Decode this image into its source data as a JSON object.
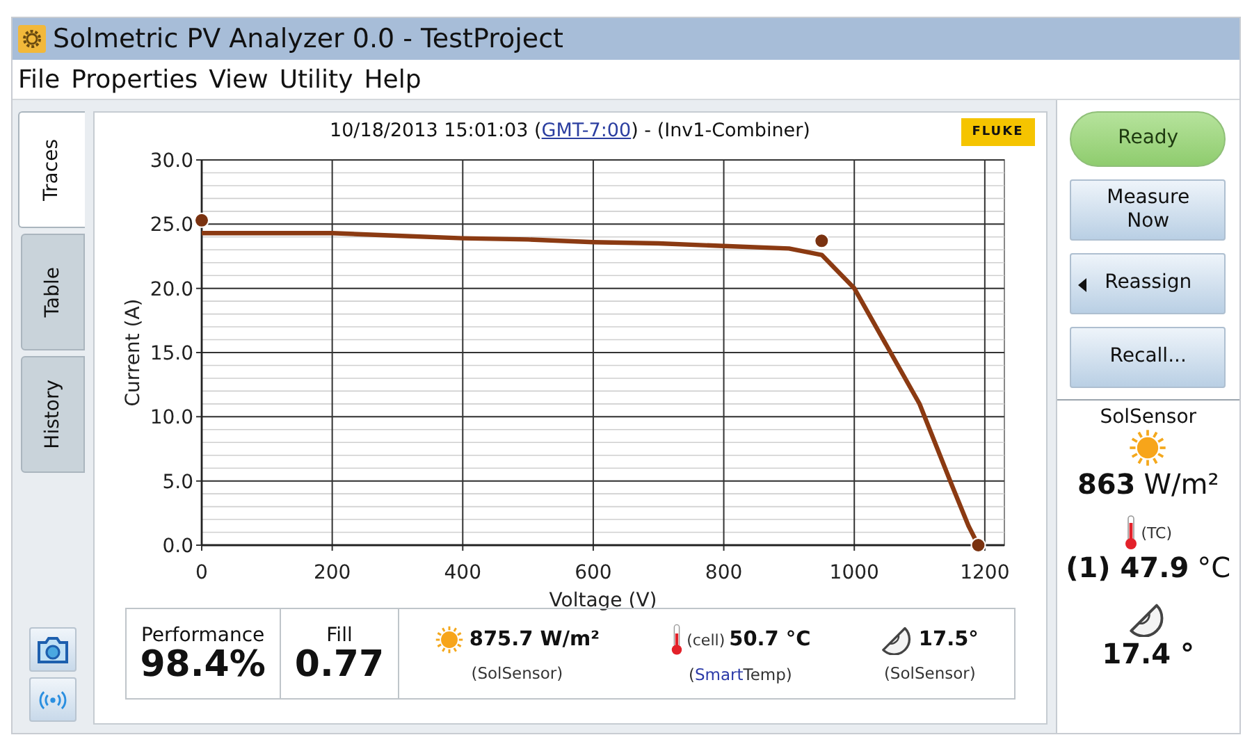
{
  "window": {
    "title": "Solmetric PV Analyzer 0.0 - TestProject"
  },
  "menu": [
    "File",
    "Properties",
    "View",
    "Utility",
    "Help"
  ],
  "side_tabs": [
    {
      "label": "Traces",
      "selected": true
    },
    {
      "label": "Table",
      "selected": false
    },
    {
      "label": "History",
      "selected": false
    }
  ],
  "side_tools": [
    {
      "kind": "camera"
    },
    {
      "kind": "wireless"
    }
  ],
  "header": {
    "before": "10/18/2013 15:01:03 (",
    "link": "GMT-7:00",
    "after": ") - (Inv1-Combiner)",
    "logo": "FLUKE"
  },
  "chart_data": {
    "type": "line",
    "xlabel": "Voltage (V)",
    "ylabel": "Current (A)",
    "x": [
      0,
      100,
      200,
      300,
      400,
      500,
      600,
      700,
      800,
      900,
      950,
      1000,
      1050,
      1100,
      1150,
      1175,
      1190
    ],
    "series": [
      {
        "color": "#8b3a12",
        "values": [
          24.3,
          24.3,
          24.3,
          24.1,
          23.9,
          23.8,
          23.6,
          23.5,
          23.3,
          23.1,
          22.6,
          20.0,
          15.5,
          11.0,
          4.6,
          1.5,
          0
        ]
      },
      {
        "type": "scatter",
        "color": "#7a3210",
        "values": [
          25.3,
          null,
          null,
          null,
          null,
          null,
          null,
          null,
          null,
          null,
          23.7,
          null,
          null,
          null,
          null,
          null,
          0
        ]
      }
    ],
    "grid": true,
    "xlim": [
      0,
      1230
    ],
    "ylim": [
      0,
      30
    ],
    "xticks": [
      0,
      200,
      400,
      600,
      800,
      1000,
      1200
    ],
    "yticks": [
      {
        "value": 0,
        "label": "0.0"
      },
      {
        "value": 5,
        "label": "5.0"
      },
      {
        "value": 10,
        "label": "10.0"
      },
      {
        "value": 15,
        "label": "15.0"
      },
      {
        "value": 20,
        "label": "20.0"
      },
      {
        "value": 25,
        "label": "25.0"
      },
      {
        "value": 30,
        "label": "30.0"
      }
    ]
  },
  "stats": [
    {
      "label": "Performance",
      "value": "98.4%"
    },
    {
      "label": "Fill",
      "value": "0.77"
    }
  ],
  "readings": [
    {
      "kind": "sun",
      "value": "875.7 W/m²",
      "source": [
        {
          "text": "(SolSensor)",
          "accent": false
        }
      ]
    },
    {
      "kind": "thermometer",
      "note": "(cell)",
      "value": "50.7 °C",
      "source": [
        {
          "text": "(",
          "accent": false
        },
        {
          "text": "Smart",
          "accent": true
        },
        {
          "text": "Temp)",
          "accent": false
        }
      ]
    },
    {
      "kind": "protractor",
      "value": "17.5°",
      "source": [
        {
          "text": "(SolSensor)",
          "accent": false
        }
      ]
    }
  ],
  "actions": [
    {
      "kind": "status",
      "label": "Ready",
      "caret": false
    },
    {
      "kind": "button",
      "label": "Measure Now",
      "caret": false
    },
    {
      "kind": "button",
      "label": "Reassign",
      "caret": true
    },
    {
      "kind": "button",
      "label": "Recall...",
      "caret": false
    }
  ],
  "sensors": {
    "title": "SolSensor",
    "irradiance": {
      "value": "863",
      "unit": "W/m²"
    },
    "temperature": {
      "note": "(TC)",
      "value": "(1) 47.9",
      "unit": "°C"
    },
    "tilt": {
      "value": "17.4 °"
    }
  }
}
